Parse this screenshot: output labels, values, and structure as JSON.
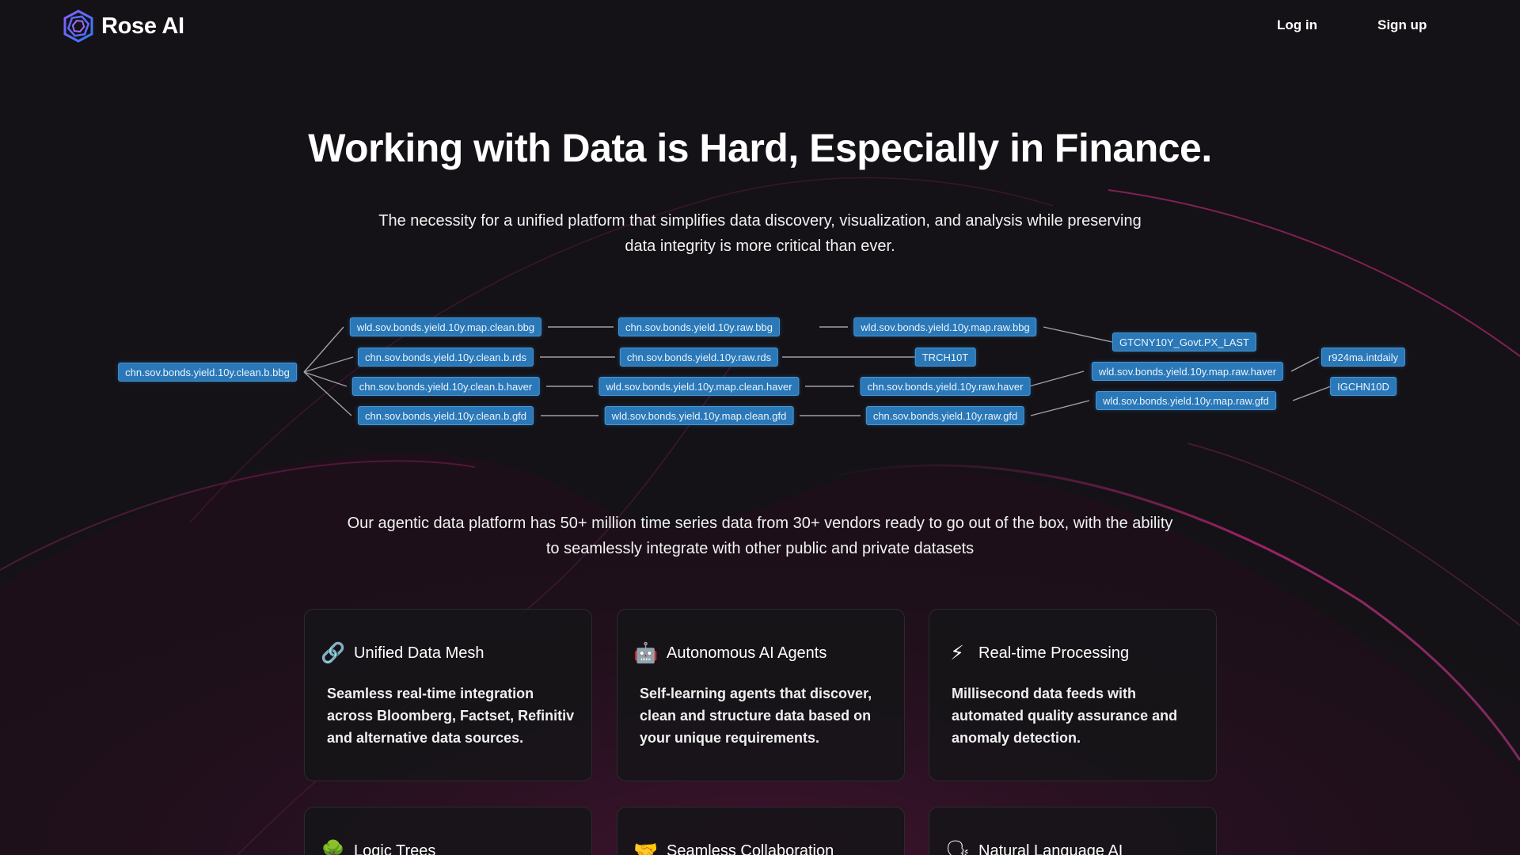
{
  "brand": {
    "name": "Rose AI"
  },
  "nav": {
    "login": "Log in",
    "signup": "Sign up"
  },
  "hero": {
    "title": "Working with Data is Hard, Especially in Finance.",
    "subtitle": "The necessity for a unified platform that simplifies data discovery, visualization, and analysis while preserving data integrity is more critical than ever."
  },
  "lineage_nodes": [
    "chn.sov.bonds.yield.10y.clean.b.bbg",
    "wld.sov.bonds.yield.10y.map.clean.bbg",
    "chn.sov.bonds.yield.10y.clean.b.rds",
    "chn.sov.bonds.yield.10y.clean.b.haver",
    "chn.sov.bonds.yield.10y.clean.b.gfd",
    "chn.sov.bonds.yield.10y.raw.bbg",
    "chn.sov.bonds.yield.10y.raw.rds",
    "wld.sov.bonds.yield.10y.map.clean.haver",
    "wld.sov.bonds.yield.10y.map.clean.gfd",
    "wld.sov.bonds.yield.10y.map.raw.bbg",
    "TRCH10T",
    "chn.sov.bonds.yield.10y.raw.haver",
    "chn.sov.bonds.yield.10y.raw.gfd",
    "GTCNY10Y_Govt.PX_LAST",
    "wld.sov.bonds.yield.10y.map.raw.haver",
    "wld.sov.bonds.yield.10y.map.raw.gfd",
    "r924ma.intdaily",
    "IGCHN10D"
  ],
  "platform_text": "Our agentic data platform has 50+ million time series data from 30+ vendors ready to go out of the box, with the ability to seamlessly integrate with other public and private datasets",
  "features": [
    {
      "icon": "🔗",
      "icon_name": "link-icon",
      "title": "Unified Data Mesh",
      "description": "Seamless real-time integration across Bloomberg, Factset, Refinitiv and alternative data sources."
    },
    {
      "icon": "🤖",
      "icon_name": "robot-icon",
      "title": "Autonomous AI Agents",
      "description": "Self-learning agents that discover, clean and structure data based on your unique requirements."
    },
    {
      "icon": "⚡",
      "icon_name": "lightning-icon",
      "title": "Real-time Processing",
      "description": "Millisecond data feeds with automated quality assurance and anomaly detection."
    },
    {
      "icon": "🌳",
      "icon_name": "tree-icon",
      "title": "Logic Trees",
      "description": ""
    },
    {
      "icon": "🤝",
      "icon_name": "handshake-icon",
      "title": "Seamless Collaboration",
      "description": ""
    },
    {
      "icon": "🗣",
      "icon_name": "speaking-head-icon",
      "title": "Natural Language AI",
      "description": ""
    }
  ],
  "colors": {
    "background": "#141216",
    "node_fill": "#2a78b8",
    "node_border": "#4b96d2",
    "accent_magenta": "#c0287a"
  }
}
